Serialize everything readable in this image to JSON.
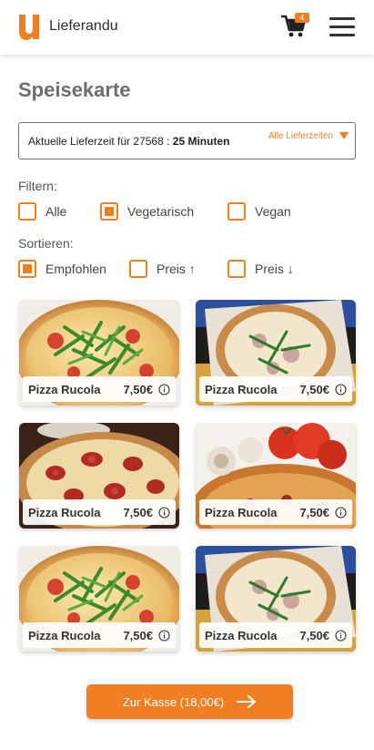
{
  "header": {
    "brand": "Lieferandu",
    "logo_letter": "u",
    "cart_count": "4",
    "cart_icon": "shopping-cart-icon",
    "menu_icon": "hamburger-menu-icon"
  },
  "page": {
    "title": "Speisekarte"
  },
  "delivery": {
    "text_prefix": "Aktuelle Lieferzeit für 27568 : ",
    "time": "25 Minuten",
    "link": "Alle Lieferzeiten"
  },
  "filters": {
    "label": "Filtern:",
    "options": [
      {
        "label": "Alle",
        "checked": false
      },
      {
        "label": "Vegetarisch",
        "checked": true
      },
      {
        "label": "Vegan",
        "checked": false
      }
    ]
  },
  "sort": {
    "label": "Sortieren:",
    "options": [
      {
        "label": "Empfohlen",
        "checked": true
      },
      {
        "label": "Preis ↑",
        "checked": false
      },
      {
        "label": "Preis ↓",
        "checked": false
      }
    ]
  },
  "items": [
    {
      "name": "Pizza Rucola",
      "price": "7,50€"
    },
    {
      "name": "Pizza Rucola",
      "price": "7,50€"
    },
    {
      "name": "Pizza Rucola",
      "price": "7,50€"
    },
    {
      "name": "Pizza Rucola",
      "price": "7,50€"
    },
    {
      "name": "Pizza Rucola",
      "price": "7,50€"
    },
    {
      "name": "Pizza Rucola",
      "price": "7,50€"
    }
  ],
  "checkout": {
    "label": "Zur Kasse (18,00€)"
  },
  "colors": {
    "accent": "#f07f23",
    "text": "#2b2b2b",
    "muted": "#6d6d6d"
  }
}
